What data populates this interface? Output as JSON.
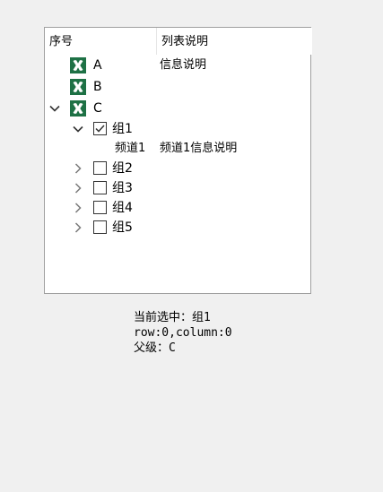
{
  "tree": {
    "columns": [
      "序号",
      "列表说明"
    ],
    "rows": [
      {
        "label": "A",
        "desc": "信息说明",
        "icon": "excel-icon"
      },
      {
        "label": "B",
        "desc": "",
        "icon": "excel-icon"
      },
      {
        "label": "C",
        "desc": "",
        "icon": "excel-icon",
        "expanded": true
      },
      {
        "label": "组1",
        "desc": "",
        "checked": true,
        "expanded": true
      },
      {
        "label": "频道1",
        "desc": "频道1信息说明"
      },
      {
        "label": "组2",
        "desc": "",
        "checked": false,
        "expanded": false
      },
      {
        "label": "组3",
        "desc": "",
        "checked": false,
        "expanded": false
      },
      {
        "label": "组4",
        "desc": "",
        "checked": false,
        "expanded": false
      },
      {
        "label": "组5",
        "desc": "",
        "checked": false,
        "expanded": false
      }
    ]
  },
  "status": {
    "line1": "当前选中：组1",
    "line2": "row:0,column:0",
    "line3": "父级：C"
  },
  "colors": {
    "excel_green": "#1e7145",
    "arrow_gray": "#7a7a7a",
    "check_border": "#333333"
  }
}
